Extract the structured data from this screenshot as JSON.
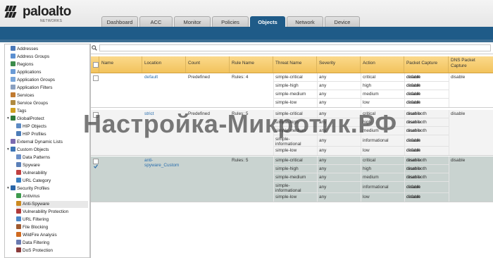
{
  "brand": {
    "name": "paloalto",
    "sub": "NETWORKS"
  },
  "tabs": [
    {
      "label": "Dashboard"
    },
    {
      "label": "ACC"
    },
    {
      "label": "Monitor"
    },
    {
      "label": "Policies"
    },
    {
      "label": "Objects",
      "active": true
    },
    {
      "label": "Network"
    },
    {
      "label": "Device"
    }
  ],
  "sidebar": {
    "items": [
      {
        "label": "Addresses",
        "level": 0,
        "icon": "address-icon"
      },
      {
        "label": "Address Groups",
        "level": 0,
        "icon": "address-group-icon"
      },
      {
        "label": "Regions",
        "level": 0,
        "icon": "region-icon"
      },
      {
        "label": "Applications",
        "level": 0,
        "icon": "application-icon"
      },
      {
        "label": "Application Groups",
        "level": 0,
        "icon": "application-group-icon"
      },
      {
        "label": "Application Filters",
        "level": 0,
        "icon": "application-filter-icon"
      },
      {
        "label": "Services",
        "level": 0,
        "icon": "service-icon"
      },
      {
        "label": "Service Groups",
        "level": 0,
        "icon": "service-group-icon"
      },
      {
        "label": "Tags",
        "level": 0,
        "icon": "tag-icon"
      },
      {
        "label": "GlobalProtect",
        "level": 0,
        "icon": "globalprotect-icon",
        "expand": true
      },
      {
        "label": "HIP Objects",
        "level": 1,
        "icon": "hip-objects-icon"
      },
      {
        "label": "HIP Profiles",
        "level": 1,
        "icon": "hip-profiles-icon"
      },
      {
        "label": "External Dynamic Lists",
        "level": 0,
        "icon": "external-list-icon"
      },
      {
        "label": "Custom Objects",
        "level": 0,
        "icon": "custom-objects-icon",
        "expand": true
      },
      {
        "label": "Data Patterns",
        "level": 1,
        "icon": "data-patterns-icon"
      },
      {
        "label": "Spyware",
        "level": 1,
        "icon": "spyware-icon"
      },
      {
        "label": "Vulnerability",
        "level": 1,
        "icon": "vulnerability-icon"
      },
      {
        "label": "URL Category",
        "level": 1,
        "icon": "url-category-icon"
      },
      {
        "label": "Security Profiles",
        "level": 0,
        "icon": "security-profiles-icon",
        "expand": true
      },
      {
        "label": "Antivirus",
        "level": 1,
        "icon": "antivirus-icon"
      },
      {
        "label": "Anti-Spyware",
        "level": 1,
        "icon": "anti-spyware-icon",
        "selected": true
      },
      {
        "label": "Vulnerability Protection",
        "level": 1,
        "icon": "vulnerability-protection-icon"
      },
      {
        "label": "URL Filtering",
        "level": 1,
        "icon": "url-filtering-icon"
      },
      {
        "label": "File Blocking",
        "level": 1,
        "icon": "file-blocking-icon"
      },
      {
        "label": "WildFire Analysis",
        "level": 1,
        "icon": "wildfire-icon"
      },
      {
        "label": "Data Filtering",
        "level": 1,
        "icon": "data-filtering-icon"
      },
      {
        "label": "DoS Protection",
        "level": 1,
        "icon": "dos-protection-icon"
      }
    ]
  },
  "search": {
    "value": "",
    "placeholder": ""
  },
  "table": {
    "columns": [
      "Name",
      "Location",
      "Count",
      "Rule Name",
      "Threat Name",
      "Severity",
      "Action",
      "Packet Capture",
      "DNS Packet Capture"
    ],
    "profiles": [
      {
        "name": "default",
        "location": "Predefined",
        "count": "Rules: 4",
        "dns_capture": "disable",
        "checked": false,
        "rules": [
          {
            "rule": "simple-critical",
            "threat": "any",
            "severity": "critical",
            "action": "default",
            "capture": "disable"
          },
          {
            "rule": "simple-high",
            "threat": "any",
            "severity": "high",
            "action": "default",
            "capture": "disable"
          },
          {
            "rule": "simple-medium",
            "threat": "any",
            "severity": "medium",
            "action": "default",
            "capture": "disable"
          },
          {
            "rule": "simple-low",
            "threat": "any",
            "severity": "low",
            "action": "default",
            "capture": "disable"
          }
        ]
      },
      {
        "name": "strict",
        "location": "Predefined",
        "count": "Rules: 5",
        "dns_capture": "disable",
        "checked": false,
        "rules": [
          {
            "rule": "simple-critical",
            "threat": "any",
            "severity": "critical",
            "action": "reset-both",
            "capture": "disable"
          },
          {
            "rule": "simple-high",
            "threat": "any",
            "severity": "high",
            "action": "reset-both",
            "capture": "disable"
          },
          {
            "rule": "simple-medium",
            "threat": "any",
            "severity": "medium",
            "action": "reset-both",
            "capture": "disable"
          },
          {
            "rule": "simple-informational",
            "threat": "any",
            "severity": "informational",
            "action": "default",
            "capture": "disable"
          },
          {
            "rule": "simple-low",
            "threat": "any",
            "severity": "low",
            "action": "default",
            "capture": "disable"
          }
        ]
      },
      {
        "name": "anti-spyware_Custom",
        "location": "",
        "count": "Rules: 5",
        "dns_capture": "disable",
        "checked": true,
        "rules": [
          {
            "rule": "simple-critical",
            "threat": "any",
            "severity": "critical",
            "action": "reset-both",
            "capture": "disable"
          },
          {
            "rule": "simple-high",
            "threat": "any",
            "severity": "high",
            "action": "reset-both",
            "capture": "disable"
          },
          {
            "rule": "simple-medium",
            "threat": "any",
            "severity": "medium",
            "action": "reset-both",
            "capture": "disable"
          },
          {
            "rule": "simple-informational",
            "threat": "any",
            "severity": "informational",
            "action": "default",
            "capture": "disable"
          },
          {
            "rule": "simple-low",
            "threat": "any",
            "severity": "low",
            "action": "default",
            "capture": "disable"
          }
        ]
      }
    ]
  },
  "watermark": "Настройка-Микротик.РФ",
  "colors": {
    "brand_blue": "#1f5b88",
    "header_gold": "#f2c35c",
    "selected_row": "#c9d3d0",
    "link": "#2a6ead"
  }
}
